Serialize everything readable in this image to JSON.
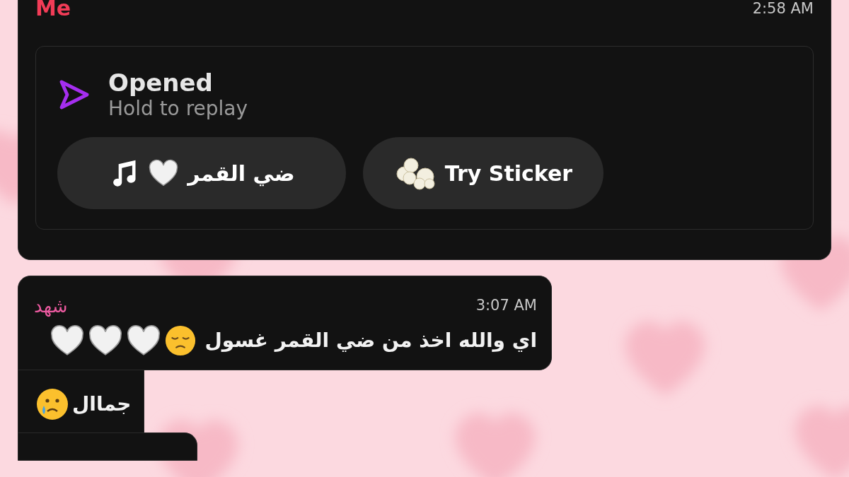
{
  "top_message": {
    "sender": "Me",
    "time": "2:58 AM",
    "status": {
      "title": "Opened",
      "subtitle": "Hold to replay"
    },
    "music_button": {
      "label": "ضي القمر"
    },
    "sticker_button": {
      "label": "Try Sticker"
    }
  },
  "messages": [
    {
      "sender": "شهد",
      "time": "3:07 AM",
      "lines": [
        {
          "kind": "sad-hearts",
          "text": "اي والله اخذ من ضي القمر غسول"
        },
        {
          "kind": "tear",
          "text": "جماال"
        }
      ]
    }
  ]
}
